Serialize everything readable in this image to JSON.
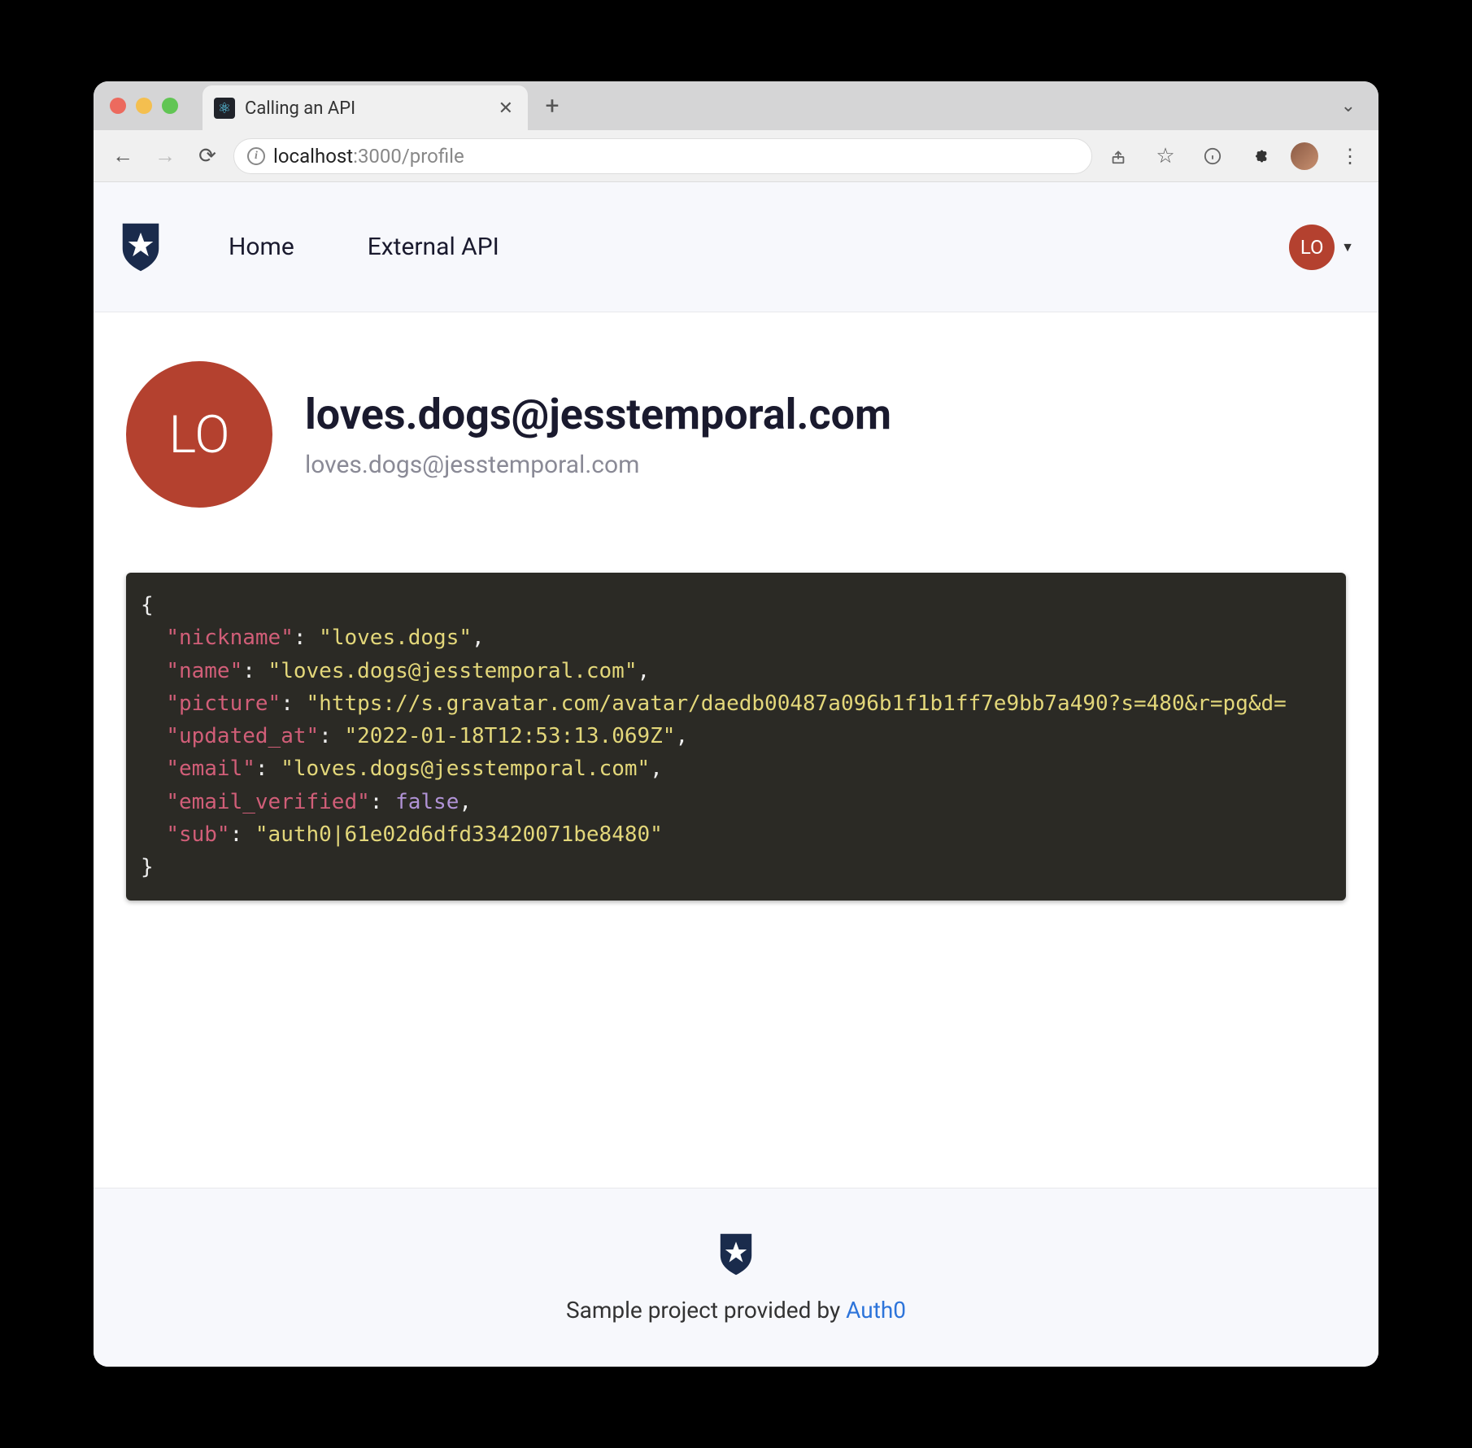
{
  "browser": {
    "tab_title": "Calling an API",
    "url_host": "localhost",
    "url_path": ":3000/profile",
    "traffic_colors": {
      "close": "#ec6a5e",
      "min": "#f4bf4f",
      "max": "#61c554"
    }
  },
  "header": {
    "nav": {
      "home": "Home",
      "external_api": "External API"
    },
    "user_initials": "LO"
  },
  "profile": {
    "initials": "LO",
    "title": "loves.dogs@jesstemporal.com",
    "subtitle": "loves.dogs@jesstemporal.com"
  },
  "json": {
    "nickname_key": "\"nickname\"",
    "nickname_val": "\"loves.dogs\"",
    "name_key": "\"name\"",
    "name_val": "\"loves.dogs@jesstemporal.com\"",
    "picture_key": "\"picture\"",
    "picture_val": "\"https://s.gravatar.com/avatar/daedb00487a096b1f1b1ff7e9bb7a490?s=480&r=pg&d=",
    "updated_key": "\"updated_at\"",
    "updated_val": "\"2022-01-18T12:53:13.069Z\"",
    "email_key": "\"email\"",
    "email_val": "\"loves.dogs@jesstemporal.com\"",
    "ev_key": "\"email_verified\"",
    "ev_val": "false",
    "sub_key": "\"sub\"",
    "sub_val": "\"auth0|61e02d6dfd33420071be8480\""
  },
  "footer": {
    "text": "Sample project provided by ",
    "link": "Auth0"
  }
}
